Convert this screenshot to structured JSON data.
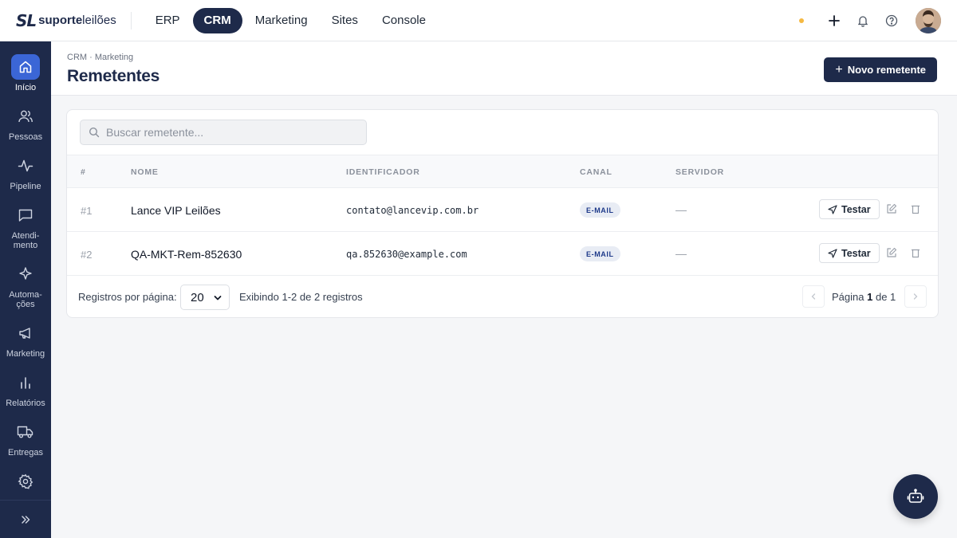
{
  "brand": {
    "mark": "SL",
    "name_bold": "suporte",
    "name_light": "leilões"
  },
  "topnav": [
    {
      "label": "ERP",
      "active": false
    },
    {
      "label": "CRM",
      "active": true
    },
    {
      "label": "Marketing",
      "active": false
    },
    {
      "label": "Sites",
      "active": false
    },
    {
      "label": "Console",
      "active": false
    }
  ],
  "topbar_icons": [
    "status-dot",
    "plus-icon",
    "bell-icon",
    "help-icon",
    "avatar"
  ],
  "sidebar": {
    "items": [
      {
        "label": "Início",
        "icon": "home-icon",
        "active": true
      },
      {
        "label": "Pessoas",
        "icon": "users-icon"
      },
      {
        "label": "Pipeline",
        "icon": "activity-icon"
      },
      {
        "label": "Atendi-\nmento",
        "icon": "chat-icon"
      },
      {
        "label": "Automa-\nções",
        "icon": "sparkle-icon"
      },
      {
        "label": "Marketing",
        "icon": "megaphone-icon"
      },
      {
        "label": "Relatórios",
        "icon": "bar-chart-icon"
      },
      {
        "label": "Entregas",
        "icon": "truck-icon"
      },
      {
        "label": "",
        "icon": "gear-icon"
      }
    ],
    "expand_icon": "chevrons-right-icon"
  },
  "header": {
    "breadcrumb": "CRM · Marketing",
    "title": "Remetentes",
    "new_button": "Novo remetente"
  },
  "search": {
    "placeholder": "Buscar remetente..."
  },
  "table": {
    "columns": [
      "#",
      "NOME",
      "IDENTIFICADOR",
      "CANAL",
      "SERVIDOR"
    ],
    "rows": [
      {
        "num": "#1",
        "name": "Lance VIP Leilões",
        "identifier": "contato@lancevip.com.br",
        "channel": "E-MAIL",
        "server": "—",
        "test": "Testar"
      },
      {
        "num": "#2",
        "name": "QA-MKT-Rem-852630",
        "identifier": "qa.852630@example.com",
        "channel": "E-MAIL",
        "server": "—",
        "test": "Testar"
      }
    ]
  },
  "footer": {
    "per_page_label": "Registros por página:",
    "per_page_value": "20",
    "info": "Exibindo 1-2 de 2 registros",
    "page_prefix": "Página",
    "page_current": "1",
    "page_of": "de 1"
  },
  "colors": {
    "primary": "#1e2a4a",
    "accent": "#3b66d6",
    "badge_bg": "#e8ecf4",
    "status_dot": "#f5b942"
  }
}
